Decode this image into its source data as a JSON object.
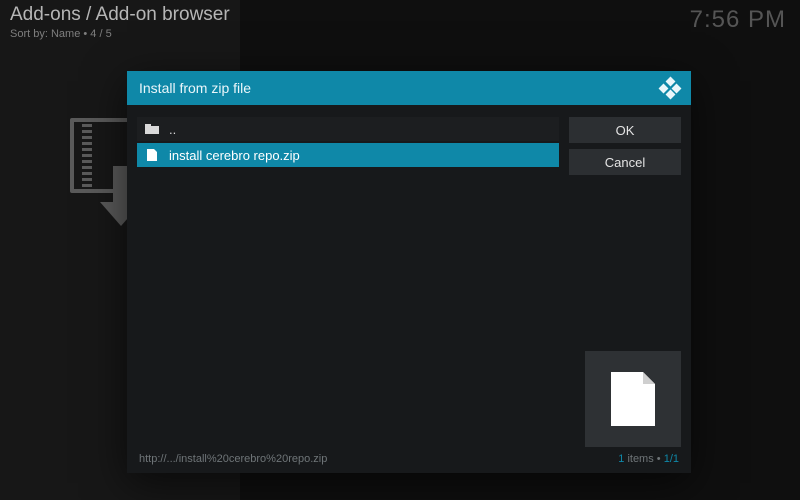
{
  "header": {
    "title": "Add-ons / Add-on browser",
    "sort_prefix": "Sort by:",
    "sort_value": "Name",
    "position": "4 / 5"
  },
  "clock": "7:56 PM",
  "dialog": {
    "title": "Install from zip file",
    "parent_label": "..",
    "rows": [
      {
        "label": "install cerebro repo.zip",
        "selected": true
      }
    ],
    "buttons": {
      "ok": "OK",
      "cancel": "Cancel"
    },
    "status_path": "http://.../install%20cerebro%20repo.zip",
    "status_count": "1",
    "status_count_word": "items",
    "status_page": "1/1"
  }
}
